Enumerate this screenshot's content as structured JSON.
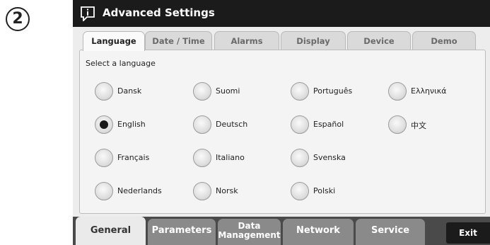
{
  "step": "2",
  "window": {
    "title": "Advanced Settings",
    "icon": "info-speech-bubble-icon"
  },
  "tabs": [
    {
      "label": "Language",
      "active": true
    },
    {
      "label": "Date / Time",
      "active": false
    },
    {
      "label": "Alarms",
      "active": false
    },
    {
      "label": "Display",
      "active": false
    },
    {
      "label": "Device",
      "active": false
    },
    {
      "label": "Demo",
      "active": false
    }
  ],
  "panel": {
    "label": "Select a language",
    "selected": "English",
    "languages": [
      "Dansk",
      "Suomi",
      "Português",
      "Ελληνικά",
      "English",
      "Deutsch",
      "Español",
      "中文",
      "Français",
      "Italiano",
      "Svenska",
      "Nederlands",
      "Norsk",
      "Polski"
    ]
  },
  "bottom_tabs": [
    {
      "label": "General",
      "active": true
    },
    {
      "label": "Parameters",
      "active": false
    },
    {
      "label": "Data",
      "label2": "Management",
      "active": false
    },
    {
      "label": "Network",
      "active": false
    },
    {
      "label": "Service",
      "active": false
    }
  ],
  "exit_label": "Exit"
}
